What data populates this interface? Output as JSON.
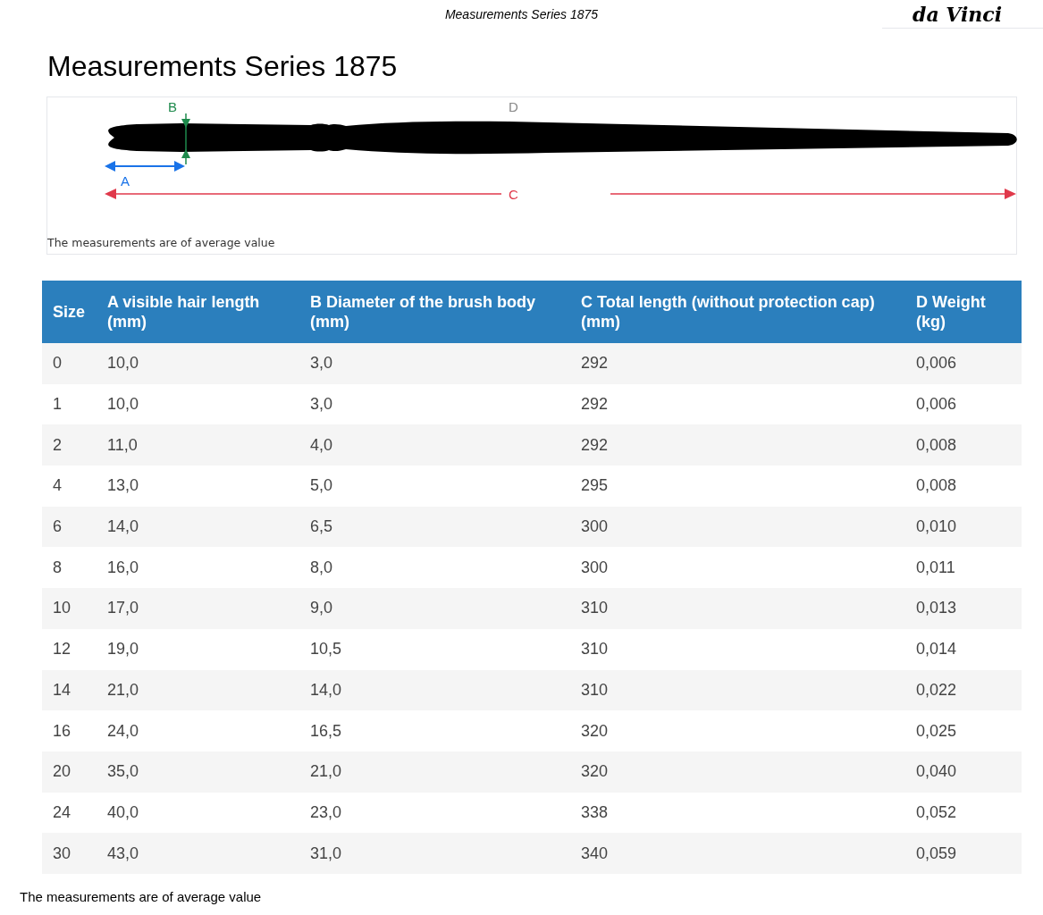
{
  "header": {
    "title": "Measurements Series 1875",
    "logo": "da Vinci"
  },
  "title": "Measurements Series 1875",
  "diagram": {
    "labels": {
      "a": "A",
      "b": "B",
      "c": "C",
      "d": "D"
    },
    "caption": "The measurements are of average value"
  },
  "table": {
    "columns": [
      "Size",
      "A visible hair length (mm)",
      "B Diameter of the brush body (mm)",
      "C Total length (without protection cap) (mm)",
      "D Weight (kg)"
    ],
    "rows": [
      [
        "0",
        "10,0",
        "3,0",
        "292",
        "0,006"
      ],
      [
        "1",
        "10,0",
        "3,0",
        "292",
        "0,006"
      ],
      [
        "2",
        "11,0",
        "4,0",
        "292",
        "0,008"
      ],
      [
        "4",
        "13,0",
        "5,0",
        "295",
        "0,008"
      ],
      [
        "6",
        "14,0",
        "6,5",
        "300",
        "0,010"
      ],
      [
        "8",
        "16,0",
        "8,0",
        "300",
        "0,011"
      ],
      [
        "10",
        "17,0",
        "9,0",
        "310",
        "0,013"
      ],
      [
        "12",
        "19,0",
        "10,5",
        "310",
        "0,014"
      ],
      [
        "14",
        "21,0",
        "14,0",
        "310",
        "0,022"
      ],
      [
        "16",
        "24,0",
        "16,5",
        "320",
        "0,025"
      ],
      [
        "20",
        "35,0",
        "21,0",
        "320",
        "0,040"
      ],
      [
        "24",
        "40,0",
        "23,0",
        "338",
        "0,052"
      ],
      [
        "30",
        "43,0",
        "31,0",
        "340",
        "0,059"
      ]
    ]
  },
  "footer": "The measurements are of average value"
}
